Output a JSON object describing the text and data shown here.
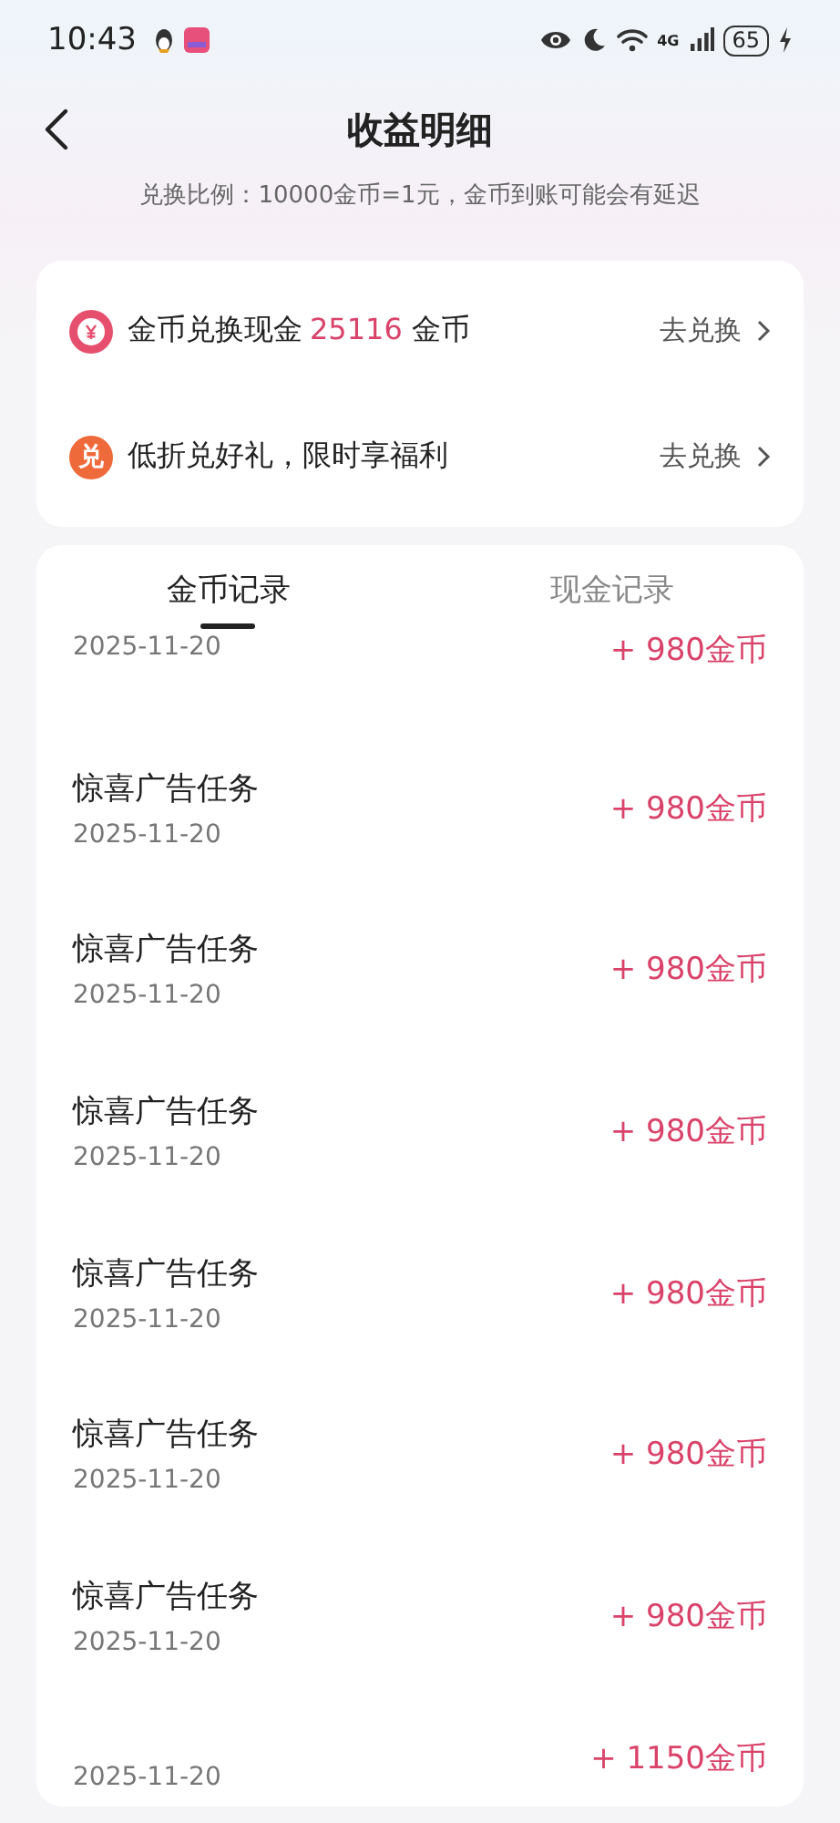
{
  "status_bar": {
    "time": "10:43",
    "network": "4G",
    "battery": "65"
  },
  "header": {
    "title": "收益明细",
    "subtitle": "兑换比例：10000金币=1元，金币到账可能会有延迟"
  },
  "exchange_rows": [
    {
      "kind": "coin",
      "text_before": "金币兑换现金",
      "amount": "25116",
      "text_after": "金币",
      "action": "去兑换"
    },
    {
      "kind": "gift",
      "icon_text": "兑",
      "text_before": "低折兑好礼，限时享福利",
      "action": "去兑换"
    }
  ],
  "tabs": [
    {
      "label": "金币记录",
      "selected": true
    },
    {
      "label": "现金记录",
      "selected": false
    }
  ],
  "records": [
    {
      "date": "2025-11-20",
      "amount": "+ 980金币"
    },
    {
      "title": "惊喜广告任务",
      "date": "2025-11-20",
      "amount": "+ 980金币"
    },
    {
      "title": "惊喜广告任务",
      "date": "2025-11-20",
      "amount": "+ 980金币"
    },
    {
      "title": "惊喜广告任务",
      "date": "2025-11-20",
      "amount": "+ 980金币"
    },
    {
      "title": "惊喜广告任务",
      "date": "2025-11-20",
      "amount": "+ 980金币"
    },
    {
      "title": "惊喜广告任务",
      "date": "2025-11-20",
      "amount": "+ 980金币"
    },
    {
      "title": "惊喜广告任务",
      "date": "2025-11-20",
      "amount": "+ 980金币"
    },
    {
      "date": "2025-11-20",
      "amount": "+ 1150金币"
    }
  ]
}
